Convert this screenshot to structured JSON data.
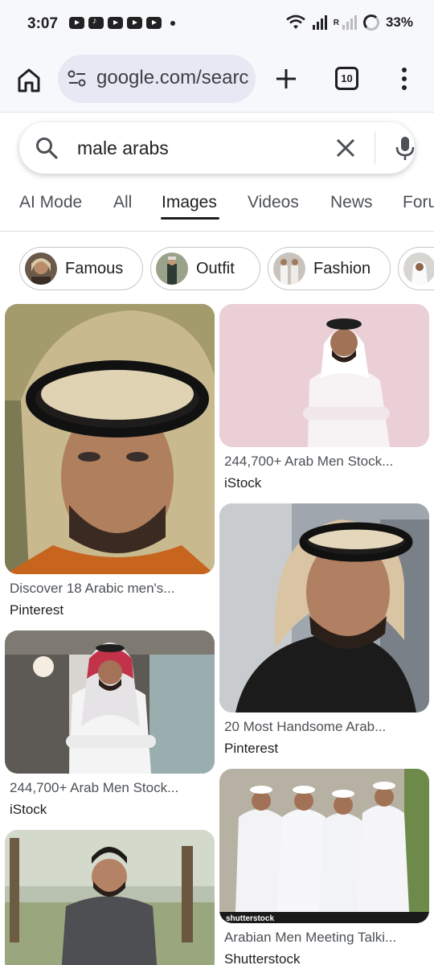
{
  "status_bar": {
    "time": "3:07",
    "app_icons": [
      "youtube-icon",
      "tiktok-icon",
      "youtube-icon",
      "youtube-icon",
      "youtube-icon"
    ],
    "roaming_label": "R",
    "battery": "33%"
  },
  "browser": {
    "url": "google.com/search",
    "tab_count": "10"
  },
  "search": {
    "query": "male arabs"
  },
  "tabs": [
    {
      "label": "AI Mode",
      "active": false
    },
    {
      "label": "All",
      "active": false
    },
    {
      "label": "Images",
      "active": true
    },
    {
      "label": "Videos",
      "active": false
    },
    {
      "label": "News",
      "active": false
    },
    {
      "label": "Forums",
      "active": false
    }
  ],
  "chips": [
    {
      "label": "Famous"
    },
    {
      "label": "Outfit"
    },
    {
      "label": "Fashion"
    },
    {
      "label": ""
    }
  ],
  "results": [
    {
      "title": "Discover 18 Arabic men's...",
      "source": "Pinterest"
    },
    {
      "title": "244,700+ Arab Men Stock...",
      "source": "iStock"
    },
    {
      "title": "20 Most Handsome Arab...",
      "source": "Pinterest"
    },
    {
      "title": "244,700+ Arab Men Stock...",
      "source": "iStock"
    },
    {
      "title": "Arabian Men Meeting Talki...",
      "source": "Shutterstock"
    },
    {
      "title": "",
      "source": ""
    }
  ],
  "watermark": "shutterstock",
  "colors": {
    "toolbar_bg": "#f7f8fc",
    "urlbar_bg": "#e6e9f3",
    "text_primary": "#1f1f1f",
    "text_secondary": "#4d5156"
  }
}
